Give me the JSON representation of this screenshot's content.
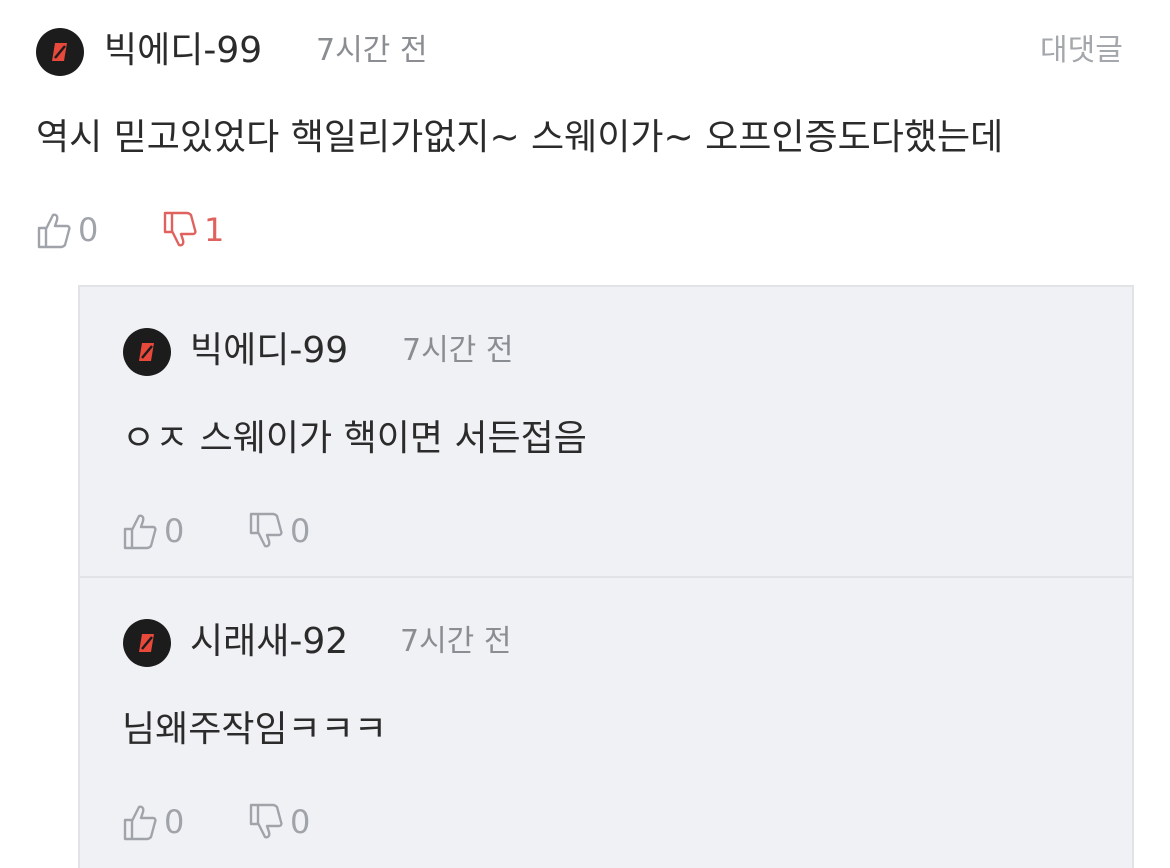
{
  "main_comment": {
    "username": "빅에디-99",
    "time": "7시간 전",
    "reply_label": "대댓글",
    "text": "역시 믿고있었다 핵일리가없지~ 스웨이가~ 오프인증도다했는데",
    "likes": "0",
    "dislikes": "1"
  },
  "replies": [
    {
      "username": "빅에디-99",
      "time": "7시간 전",
      "text": "ㅇㅈ 스웨이가 핵이면 서든접음",
      "likes": "0",
      "dislikes": "0"
    },
    {
      "username": "시래새-92",
      "time": "7시간 전",
      "text": "님왜주작임ㅋㅋㅋ",
      "likes": "0",
      "dislikes": "0"
    }
  ],
  "colors": {
    "dislike_active": "#e0625f",
    "inactive": "#a0a4aa",
    "avatar_bg": "#1c1c1c",
    "avatar_mark": "#e8493b",
    "reply_bg": "#f0f1f4"
  },
  "icons": {
    "like": "thumbs-up-icon",
    "dislike": "thumbs-down-icon",
    "avatar": "rank-badge-icon"
  }
}
